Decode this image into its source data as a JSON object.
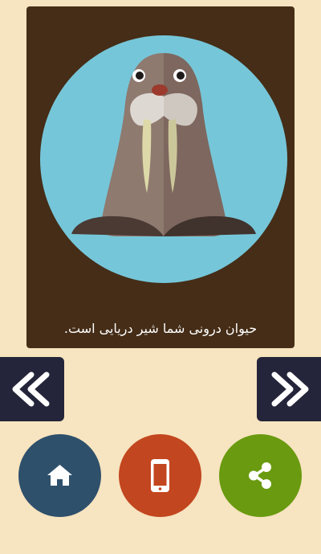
{
  "result": {
    "animal_image": "walrus-illustration",
    "caption": "حیوان درونی شما شیر دریایی است."
  },
  "navigation": {
    "previous_icon": "double-chevron-left-icon",
    "next_icon": "double-chevron-right-icon"
  },
  "actions": [
    {
      "name": "home",
      "icon": "home-icon",
      "color": "#2e506b"
    },
    {
      "name": "phone",
      "icon": "phone-icon",
      "color": "#c2461f"
    },
    {
      "name": "share",
      "icon": "share-icon",
      "color": "#6a9a10"
    }
  ],
  "colors": {
    "background": "#f7e4c0",
    "card": "#452d17",
    "circle_background": "#76c6d9",
    "nav_button": "#24253a"
  }
}
